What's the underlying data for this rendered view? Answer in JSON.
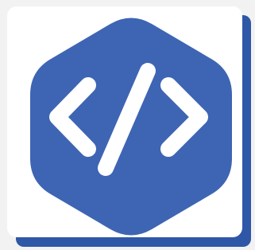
{
  "icon": {
    "name": "code-icon",
    "colors": {
      "tile": "#ffffff",
      "shadow": "#2e57a7",
      "hexagon": "#3e65b3",
      "glyph": "#ffffff"
    }
  }
}
